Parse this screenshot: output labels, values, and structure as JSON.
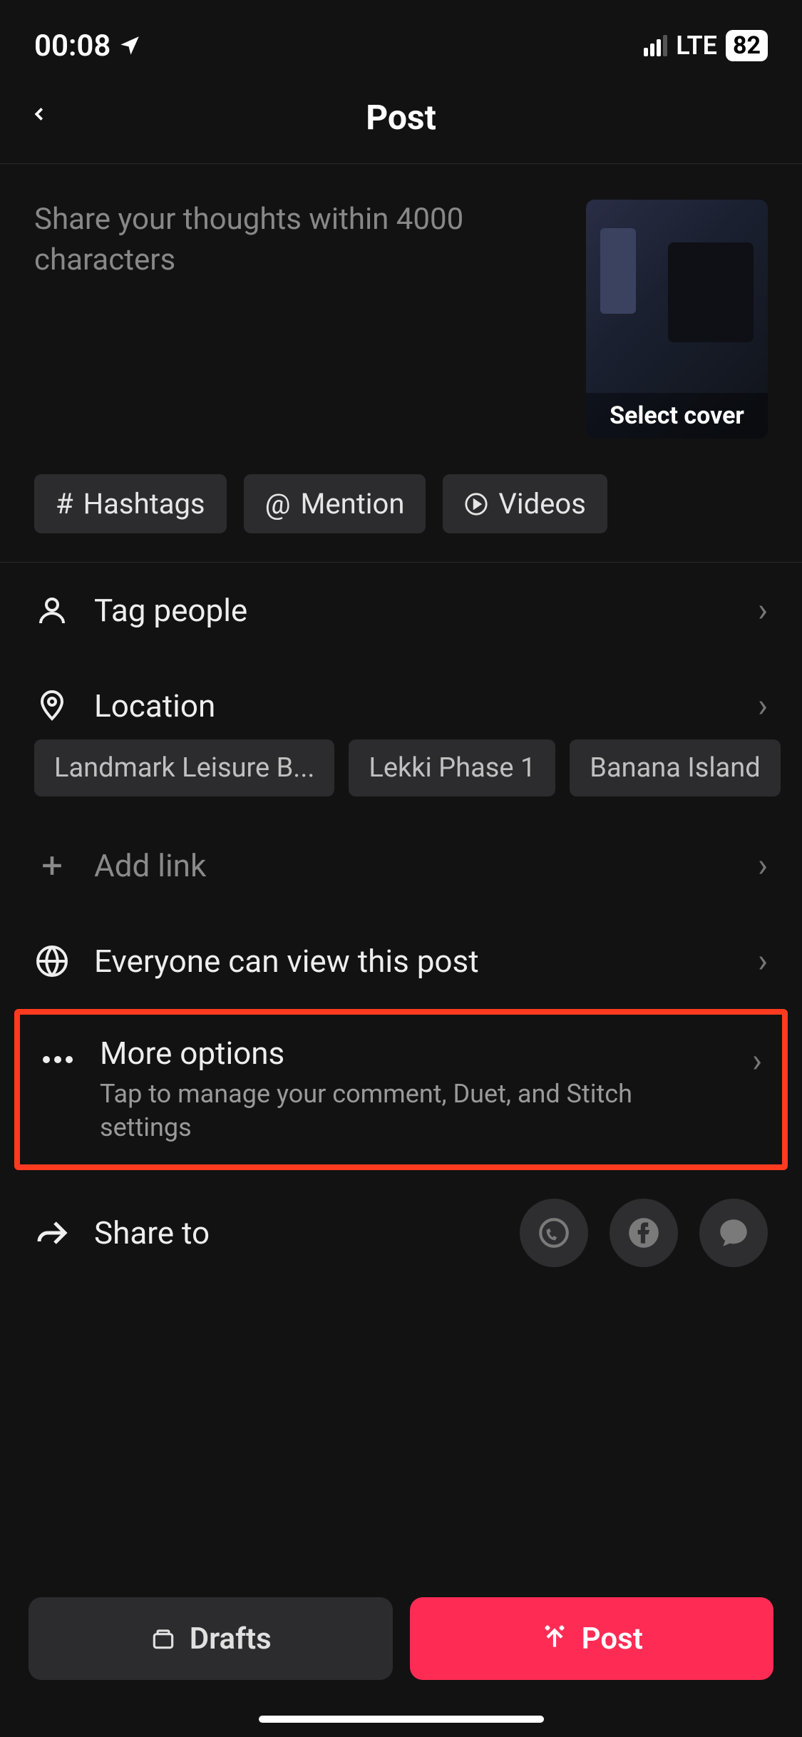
{
  "status": {
    "time": "00:08",
    "network": "LTE",
    "battery": "82"
  },
  "header": {
    "title": "Post"
  },
  "compose": {
    "placeholder": "Share your thoughts within 4000 characters",
    "select_cover": "Select cover"
  },
  "chips": {
    "hashtags": "Hashtags",
    "mention": "Mention",
    "videos": "Videos"
  },
  "options": {
    "tag_people": "Tag people",
    "location": "Location",
    "add_link": "Add link",
    "privacy": "Everyone can view this post",
    "more_options_title": "More options",
    "more_options_sub": "Tap to manage your comment, Duet, and Stitch settings",
    "share_to": "Share to"
  },
  "locations": [
    "Landmark Leisure B...",
    "Lekki Phase 1",
    "Banana Island"
  ],
  "actions": {
    "drafts": "Drafts",
    "post": "Post"
  }
}
